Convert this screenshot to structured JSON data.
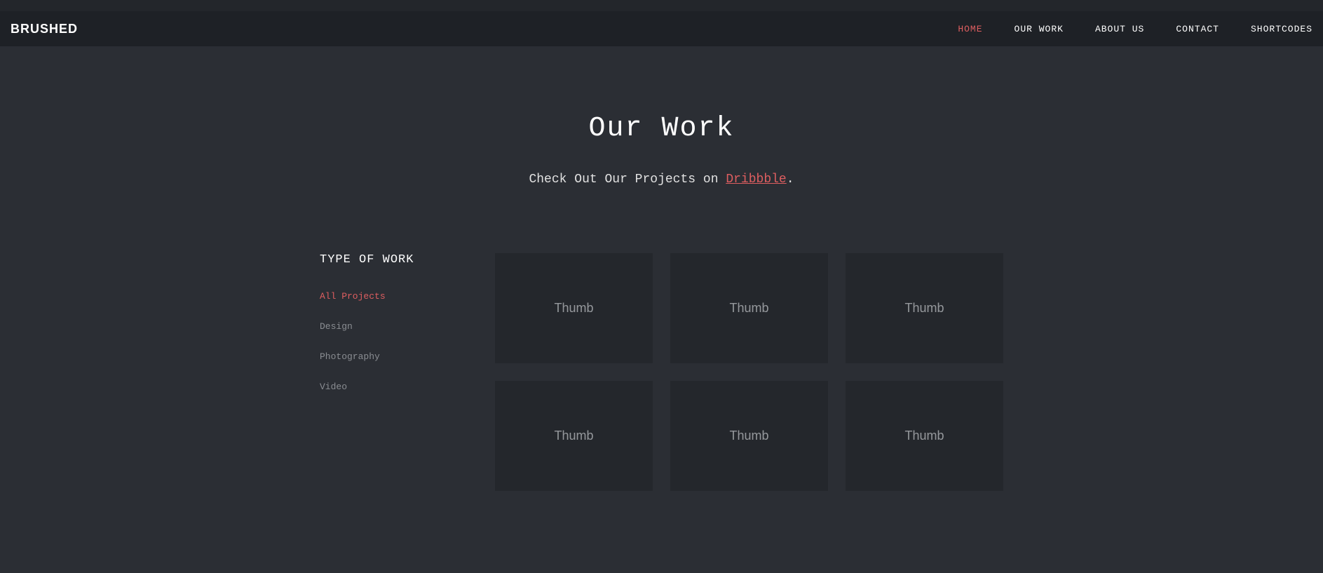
{
  "brand": "BRUSHED",
  "nav": {
    "items": [
      {
        "label": "HOME",
        "active": true
      },
      {
        "label": "OUR WORK",
        "active": false
      },
      {
        "label": "ABOUT US",
        "active": false
      },
      {
        "label": "CONTACT",
        "active": false
      },
      {
        "label": "SHORTCODES",
        "active": false
      }
    ]
  },
  "section": {
    "title": "Our Work",
    "subtitle_prefix": "Check Out Our Projects on ",
    "subtitle_link": "Dribbble",
    "subtitle_suffix": "."
  },
  "filters": {
    "title": "TYPE OF WORK",
    "items": [
      {
        "label": "All Projects",
        "active": true
      },
      {
        "label": "Design",
        "active": false
      },
      {
        "label": "Photography",
        "active": false
      },
      {
        "label": "Video",
        "active": false
      }
    ]
  },
  "thumbs": {
    "label": "Thumb",
    "items": [
      {
        "label": "Thumb"
      },
      {
        "label": "Thumb"
      },
      {
        "label": "Thumb"
      },
      {
        "label": "Thumb"
      },
      {
        "label": "Thumb"
      },
      {
        "label": "Thumb"
      }
    ]
  }
}
